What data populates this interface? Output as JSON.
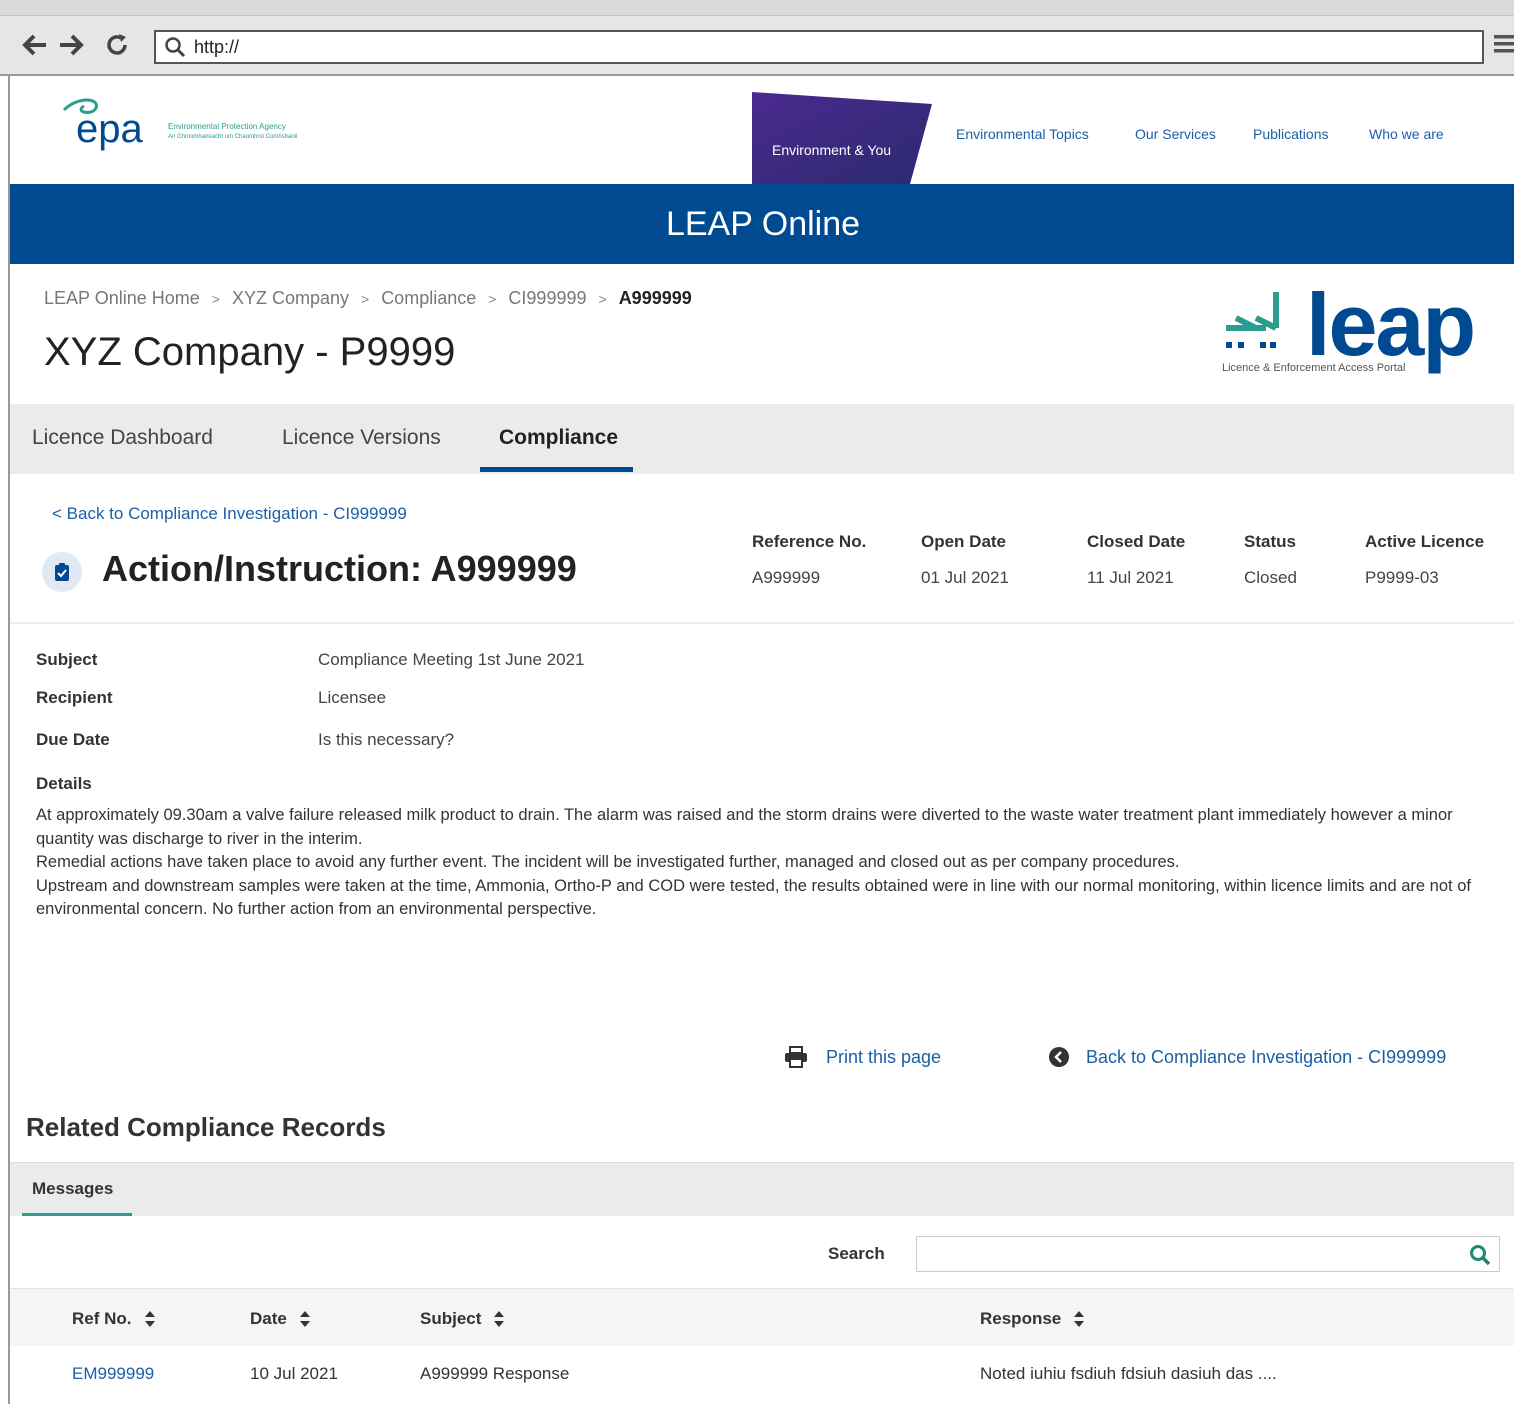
{
  "browser": {
    "url": "http://"
  },
  "site": {
    "org_line1": "Environmental Protection Agency",
    "org_line2": "An Ghníomhaireacht um Chaomhnú Comhshaoil",
    "epa_logo_text": "epa",
    "nav": [
      "Environment & You",
      "Environmental Topics",
      "Our Services",
      "Publications",
      "Who we are"
    ]
  },
  "banner": {
    "title": "LEAP Online"
  },
  "breadcrumb": [
    "LEAP Online Home",
    "XYZ Company",
    "Compliance",
    "CI999999",
    "A999999"
  ],
  "breadcrumb_sep": ">",
  "page_title": "XYZ Company - P9999",
  "leap_logo": {
    "word": "leap",
    "subtitle": "Licence & Enforcement Access Portal"
  },
  "tabs": [
    "Licence Dashboard",
    "Licence Versions",
    "Compliance"
  ],
  "back_link": "< Back to Compliance Investigation - CI999999",
  "action_title": "Action/Instruction: A999999",
  "meta": {
    "headers": [
      "Reference No.",
      "Open Date",
      "Closed Date",
      "Status",
      "Active Licence"
    ],
    "values": [
      "A999999",
      "01 Jul 2021",
      "11 Jul 2021",
      "Closed",
      "P9999-03"
    ]
  },
  "fields": {
    "subject_label": "Subject",
    "subject": "Compliance Meeting 1st June 2021",
    "recipient_label": "Recipient",
    "recipient": "Licensee",
    "due_label": "Due Date",
    "due": "Is this necessary?",
    "details_label": "Details"
  },
  "details": [
    "At approximately 09.30am a valve failure released milk product to drain. The alarm was raised and the storm drains were diverted to the waste water treatment plant immediately however a minor quantity was discharge to river in the interim.",
    "Remedial actions have taken place to avoid any further event. The incident will be investigated further, managed and closed out as per company procedures.",
    "Upstream and downstream samples were taken at the time, Ammonia, Ortho-P and COD were tested, the results obtained were in line with our normal monitoring, within licence limits and are not of environmental concern. No further action from an environmental perspective."
  ],
  "actions": {
    "print": "Print this page",
    "back": "Back to Compliance Investigation - CI999999"
  },
  "related": {
    "title": "Related Compliance Records",
    "tab": "Messages",
    "search_label": "Search",
    "search_value": "",
    "columns": [
      "Ref No.",
      "Date",
      "Subject",
      "Response"
    ],
    "rows": [
      [
        "EM999999",
        "10 Jul 2021",
        "A999999 Response",
        "Noted iuhiu fsdiuh fdsiuh dasiuh das ...."
      ]
    ]
  },
  "colors": {
    "brand_blue": "#004a91",
    "link_blue": "#1b5fa7",
    "teal": "#2a9d8f",
    "purple_tab": "#5b2a8c"
  }
}
